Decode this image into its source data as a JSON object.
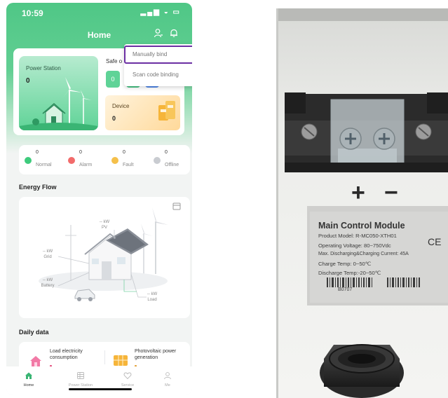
{
  "status_bar": {
    "time": "10:59",
    "icons": "▂▄▆ ◒ ▭"
  },
  "header": {
    "title": "Home"
  },
  "power_station": {
    "label": "Power Station",
    "value": "0"
  },
  "safe": {
    "label": "Safe o",
    "value": "0"
  },
  "device": {
    "label": "Device",
    "value": "0"
  },
  "menu": {
    "items": [
      "Manually bind",
      "Scan code binding"
    ]
  },
  "statuses": [
    {
      "count": "0",
      "label": "Normal",
      "color": "#3ecb7c"
    },
    {
      "count": "0",
      "label": "Alarm",
      "color": "#f26b6b"
    },
    {
      "count": "0",
      "label": "Fault",
      "color": "#f5c04a"
    },
    {
      "count": "0",
      "label": "Offline",
      "color": "#c9ccd1"
    }
  ],
  "energy_flow": {
    "title": "Energy Flow",
    "pv": {
      "value": "-- kW",
      "label": "PV"
    },
    "grid": {
      "value": "-- kW",
      "label": "Grid"
    },
    "battery": {
      "value": "-- kW",
      "label": "Battery"
    },
    "load": {
      "value": "-- kW",
      "label": "Load"
    }
  },
  "daily": {
    "title": "Daily data",
    "items": [
      {
        "label": "Load electricity consumption"
      },
      {
        "label": "Photovoltaic power generation"
      }
    ]
  },
  "tabs": [
    {
      "label": "Home",
      "icon": "home-icon",
      "active": true
    },
    {
      "label": "Power Station",
      "icon": "grid-icon",
      "active": false
    },
    {
      "label": "Service",
      "icon": "heart-icon",
      "active": false
    },
    {
      "label": "Me",
      "icon": "user-icon",
      "active": false
    }
  ],
  "photo": {
    "polarity": {
      "plus": "+",
      "minus": "−"
    },
    "module_title": "Main Control Module",
    "lines": [
      "Product Model: R-MC050-XTH01",
      "Operating Voltage: 80~750Vdc",
      "Max. Discharging&Charging Current: 45A",
      "Charge Temp: 0~50℃",
      "Discharge Temp:-20~50℃"
    ],
    "ce_mark": "CE",
    "serial": "B0707"
  },
  "colors": {
    "brand_green": "#4fc786",
    "menu_highlight": "#6b2fa3"
  }
}
